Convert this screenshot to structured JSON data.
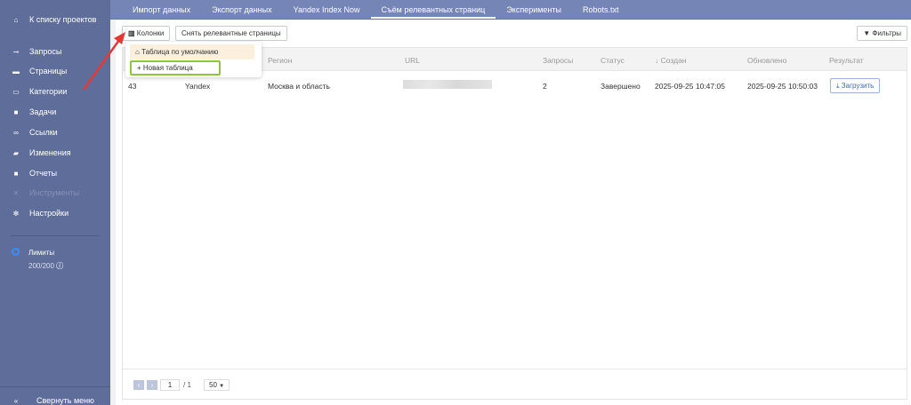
{
  "sidebar": {
    "back": "К списку проектов",
    "items": [
      {
        "label": "Запросы",
        "icon": "key-icon"
      },
      {
        "label": "Страницы",
        "icon": "page-icon"
      },
      {
        "label": "Категории",
        "icon": "folder-icon"
      },
      {
        "label": "Задачи",
        "icon": "task-icon"
      },
      {
        "label": "Ссылки",
        "icon": "link-icon"
      },
      {
        "label": "Изменения",
        "icon": "changes-icon"
      },
      {
        "label": "Отчеты",
        "icon": "report-icon"
      },
      {
        "label": "Инструменты",
        "icon": "tools-icon",
        "disabled": true
      },
      {
        "label": "Настройки",
        "icon": "gear-icon"
      }
    ],
    "limits_label": "Лимиты",
    "limits_value": "200/200",
    "collapse": "Свернуть меню"
  },
  "tabs": [
    "Импорт данных",
    "Экспорт данных",
    "Yandex Index Now",
    "Съём релевантных страниц",
    "Эксперименты",
    "Robots.txt"
  ],
  "active_tab": 3,
  "toolbar": {
    "columns": "Колонки",
    "scrape": "Снять релевантные страницы",
    "filters": "Фильтры"
  },
  "dropdown": {
    "default": "Таблица по умолчанию",
    "new": "Новая таблица"
  },
  "table": {
    "headers": [
      "Регион",
      "URL",
      "Запросы",
      "Статус",
      "Создан",
      "Обновлено",
      "Результат"
    ],
    "sort_column": "Создан",
    "rows": [
      {
        "id": "43",
        "engine": "Yandex",
        "region": "Москва и область",
        "url": "",
        "queries": "2",
        "status": "Завершено",
        "created": "2025-09-25 10:47:05",
        "updated": "2025-09-25 10:50:03",
        "result": "Загрузить"
      }
    ]
  },
  "pagination": {
    "page": "1",
    "total": "/ 1",
    "per_page": "50"
  },
  "colors": {
    "sidebar": "#5f6d9a",
    "topbar": "#7585b5",
    "highlight": "#8dc63f",
    "arrow": "#e53935",
    "accent": "#3d6bb3"
  }
}
